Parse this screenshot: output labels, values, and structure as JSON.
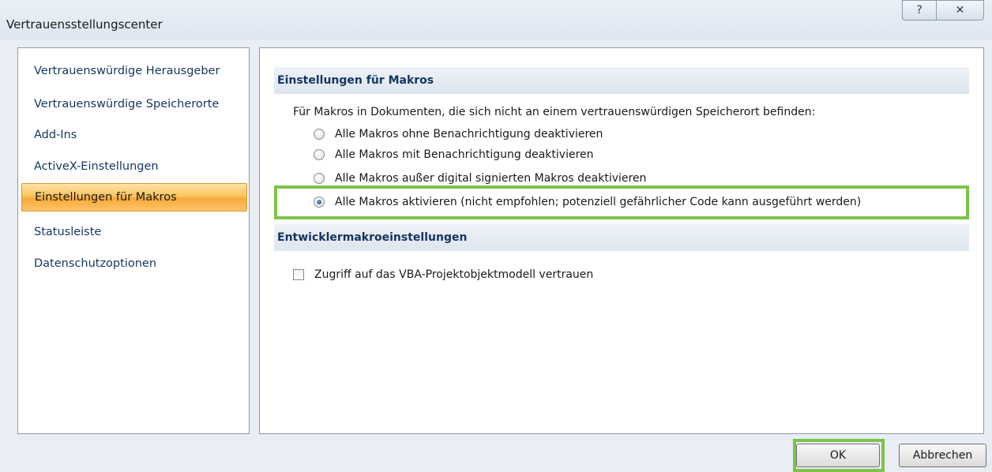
{
  "window": {
    "title": "Vertrauensstellungscenter",
    "help_icon": "?",
    "close_icon": "✕"
  },
  "sidebar": {
    "items": [
      {
        "label": "Vertrauenswürdige Herausgeber",
        "active": false
      },
      {
        "label": "Vertrauenswürdige Speicherorte",
        "active": false
      },
      {
        "label": "Add-Ins",
        "active": false
      },
      {
        "label": "ActiveX-Einstellungen",
        "active": false
      },
      {
        "label": "Einstellungen für Makros",
        "active": true
      },
      {
        "label": "Statusleiste",
        "active": false
      },
      {
        "label": "Datenschutzoptionen",
        "active": false
      }
    ]
  },
  "macro_settings": {
    "header": "Einstellungen für Makros",
    "description": "Für Makros in Dokumenten, die sich nicht an einem vertrauenswürdigen Speicherort befinden:",
    "options": [
      {
        "label": "Alle Makros ohne Benachrichtigung deaktivieren",
        "checked": false
      },
      {
        "label": "Alle Makros mit Benachrichtigung deaktivieren",
        "checked": false
      },
      {
        "label": "Alle Makros außer digital signierten Makros deaktivieren",
        "checked": false
      },
      {
        "label": "Alle Makros aktivieren (nicht empfohlen; potenziell gefährlicher Code kann ausgeführt werden)",
        "checked": true
      }
    ]
  },
  "developer_settings": {
    "header": "Entwicklermakroeinstellungen",
    "vba_trust_label": "Zugriff auf das VBA-Projektobjektmodell vertrauen",
    "vba_trust_checked": false
  },
  "buttons": {
    "ok": "OK",
    "cancel": "Abbrechen"
  },
  "colors": {
    "highlight": "#7dc24b",
    "active_item": "#fbc45f",
    "header_text": "#15355e"
  }
}
